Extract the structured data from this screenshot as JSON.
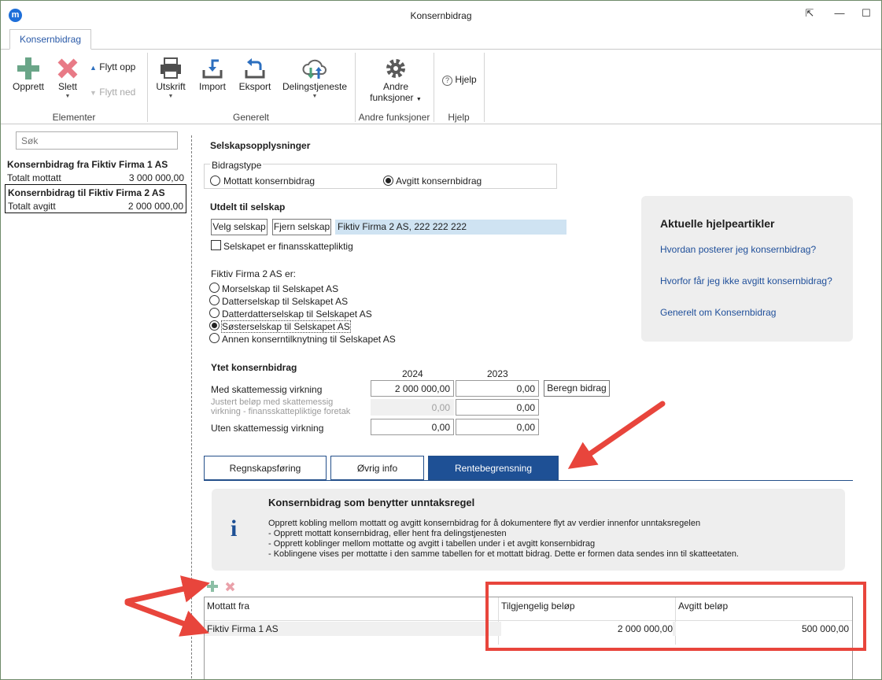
{
  "window": {
    "title": "Konsernbidrag"
  },
  "ribbon": {
    "tab": "Konsernbidrag",
    "buttons": {
      "opprett": "Opprett",
      "slett": "Slett",
      "flytt_opp": "Flytt opp",
      "flytt_ned": "Flytt ned",
      "utskrift": "Utskrift",
      "import": "Import",
      "eksport": "Eksport",
      "delingstjeneste": "Delingstjeneste",
      "andre_1": "Andre",
      "andre_2": "funksjoner",
      "hjelp": "Hjelp"
    },
    "groups": {
      "elementer": "Elementer",
      "generelt": "Generelt",
      "andre": "Andre funksjoner",
      "hjelp": "Hjelp"
    }
  },
  "sidebar": {
    "search_placeholder": "Søk",
    "items": [
      {
        "title": "Konsernbidrag fra Fiktiv Firma 1 AS",
        "label": "Totalt mottatt",
        "value": "3 000 000,00"
      },
      {
        "title": "Konsernbidrag til Fiktiv Firma 2 AS",
        "label": "Totalt avgitt",
        "value": "2 000 000,00"
      }
    ]
  },
  "form": {
    "section1": "Selskapsopplysninger",
    "bidragstype": {
      "legend": "Bidragstype",
      "options": [
        "Mottatt konsernbidrag",
        "Avgitt konsernbidrag"
      ],
      "selected": 1
    },
    "section2": "Utdelt til selskap",
    "velg": "Velg selskap",
    "fjern": "Fjern selskap",
    "company": "Fiktiv Firma 2 AS, 222 222 222",
    "finansskatt": "Selskapet er finansskattepliktig",
    "relation_label": "Fiktiv Firma 2 AS er:",
    "relations": [
      "Morselskap til Selskapet AS",
      "Datterselskap til Selskapet AS",
      "Datterdatterselskap til Selskapet AS",
      "Søsterselskap til Selskapet AS",
      "Annen konserntilknytning til Selskapet AS"
    ],
    "relation_selected": 3,
    "section3": "Ytet konsernbidrag",
    "year1": "2024",
    "year2": "2023",
    "rows": [
      {
        "label": "Med skattemessig virkning",
        "v1": "2 000 000,00",
        "v2": "0,00"
      },
      {
        "label1": "Justert beløp med skattemessig",
        "label2": "virkning - finansskattepliktige foretak",
        "v1": "0,00",
        "v2": "0,00"
      },
      {
        "label": "Uten skattemessig virkning",
        "v1": "0,00",
        "v2": "0,00"
      }
    ],
    "beregn": "Beregn bidrag"
  },
  "help": {
    "title": "Aktuelle hjelpeartikler",
    "links": [
      "Hvordan posterer jeg konsernbidrag?",
      "Hvorfor får jeg ikke avgitt konsernbidrag?",
      "Generelt om Konsernbidrag"
    ]
  },
  "tabs": [
    "Regnskapsføring",
    "Øvrig info",
    "Rentebegrensning"
  ],
  "active_tab": 2,
  "info": {
    "title": "Konsernbidrag som benytter unntaksregel",
    "lines": [
      "Opprett kobling mellom mottatt og avgitt konsernbidrag for å dokumentere flyt av verdier innenfor unntaksregelen",
      "- Opprett mottatt konsernbidrag, eller hent fra delingstjenesten",
      "- Opprett koblinger mellom mottatte og avgitt i tabellen under i et avgitt konsernbidrag",
      "- Koblingene vises per mottatte i den samme tabellen for et mottatt bidrag. Dette er formen data sendes inn til skatteetaten."
    ]
  },
  "table": {
    "headers": [
      "Mottatt fra",
      "Tilgjengelig beløp",
      "Avgitt beløp"
    ],
    "rows": [
      {
        "from": "Fiktiv Firma 1 AS",
        "available": "2 000 000,00",
        "given": "500 000,00"
      }
    ]
  },
  "colors": {
    "accent": "#1e5095",
    "annotation": "#e8453c",
    "highlight": "#cfe3f2"
  }
}
